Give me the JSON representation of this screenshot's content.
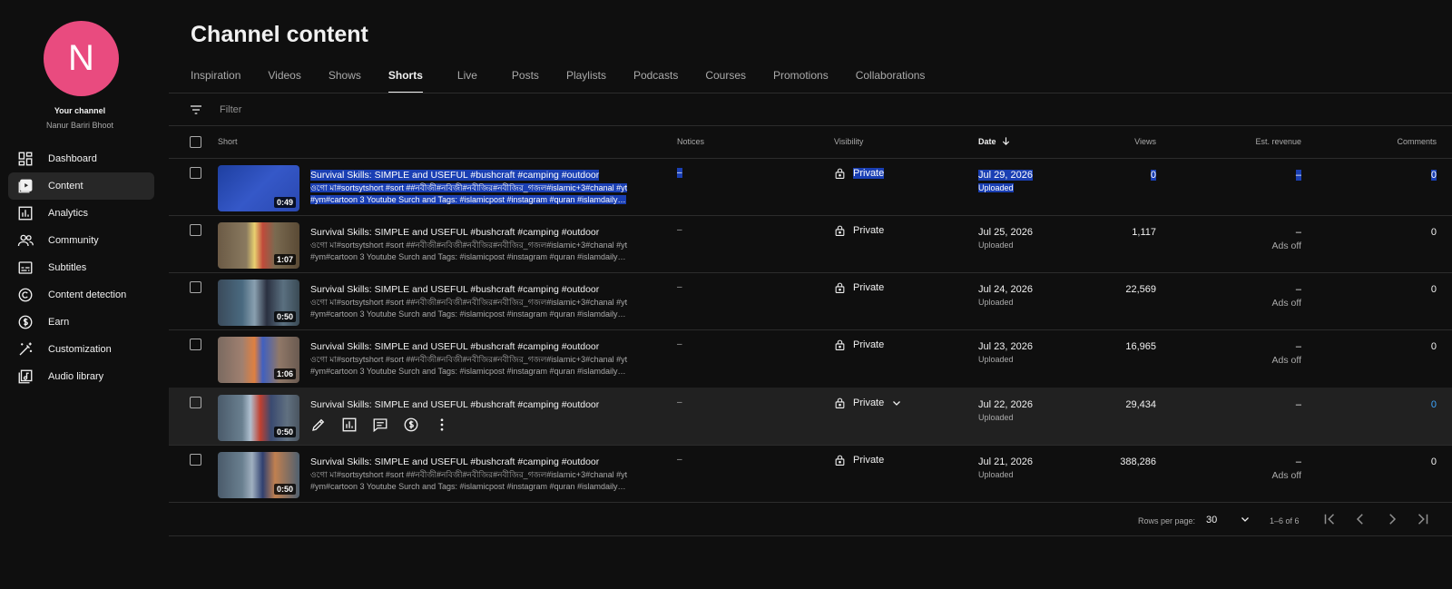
{
  "sidebar": {
    "avatar_letter": "N",
    "avatar_color": "#e94b7f",
    "your_channel": "Your channel",
    "channel_name": "Nanur Bariri Bhoot",
    "items": [
      {
        "label": "Dashboard",
        "icon": "dashboard-icon"
      },
      {
        "label": "Content",
        "icon": "content-icon"
      },
      {
        "label": "Analytics",
        "icon": "analytics-icon"
      },
      {
        "label": "Community",
        "icon": "community-icon"
      },
      {
        "label": "Subtitles",
        "icon": "subtitles-icon"
      },
      {
        "label": "Content detection",
        "icon": "copyright-icon"
      },
      {
        "label": "Earn",
        "icon": "dollar-icon"
      },
      {
        "label": "Customization",
        "icon": "magic-wand-icon"
      },
      {
        "label": "Audio library",
        "icon": "audio-library-icon"
      }
    ]
  },
  "main": {
    "title": "Channel content",
    "tabs": [
      "Inspiration",
      "Videos",
      "Shows",
      "Shorts",
      "Live",
      "Posts",
      "Playlists",
      "Podcasts",
      "Courses",
      "Promotions",
      "Collaborations"
    ],
    "active_tab": "Shorts",
    "filter_placeholder": "Filter",
    "columns": {
      "short": "Short",
      "notices": "Notices",
      "visibility": "Visibility",
      "date": "Date",
      "views": "Views",
      "revenue": "Est. revenue",
      "comments": "Comments"
    }
  },
  "rows": [
    {
      "duration": "0:49",
      "title": "Survival Skills: SIMPLE and USEFUL #bushcraft #camping #outdoor",
      "desc": "ওগো মা#sortsytshort #sort ##নবীজী#নবিজী#নবীজির#নবীজির_গজল#islamic+3#chanal #yt #ym#cartoon 3 Youtube Surch and Tags: #islamicpost #instagram #quran #islamdaily…",
      "notices": "–",
      "visibility": "Private",
      "date": "Jul 29, 2026",
      "status": "Uploaded",
      "views": "0",
      "revenue": "–",
      "revenue_note": "",
      "comments": "0"
    },
    {
      "duration": "1:07",
      "title": "Survival Skills: SIMPLE and USEFUL #bushcraft #camping #outdoor",
      "desc": "ওগো মা#sortsytshort #sort ##নবীজী#নবিজী#নবীজির#নবীজির_গজল#islamic+3#chanal #yt #ym#cartoon 3 Youtube Surch and Tags: #islamicpost #instagram #quran #islamdaily…",
      "notices": "–",
      "visibility": "Private",
      "date": "Jul 25, 2026",
      "status": "Uploaded",
      "views": "1,117",
      "revenue": "–",
      "revenue_note": "Ads off",
      "comments": "0"
    },
    {
      "duration": "0:50",
      "title": "Survival Skills: SIMPLE and USEFUL #bushcraft #camping #outdoor",
      "desc": "ওগো মা#sortsytshort #sort ##নবীজী#নবিজী#নবীজির#নবীজির_গজল#islamic+3#chanal #yt #ym#cartoon 3 Youtube Surch and Tags: #islamicpost #instagram #quran #islamdaily…",
      "notices": "–",
      "visibility": "Private",
      "date": "Jul 24, 2026",
      "status": "Uploaded",
      "views": "22,569",
      "revenue": "–",
      "revenue_note": "Ads off",
      "comments": "0"
    },
    {
      "duration": "1:06",
      "title": "Survival Skills: SIMPLE and USEFUL #bushcraft #camping #outdoor",
      "desc": "ওগো মা#sortsytshort #sort ##নবীজী#নবিজী#নবীজির#নবীজির_গজল#islamic+3#chanal #yt #ym#cartoon 3 Youtube Surch and Tags: #islamicpost #instagram #quran #islamdaily…",
      "notices": "–",
      "visibility": "Private",
      "date": "Jul 23, 2026",
      "status": "Uploaded",
      "views": "16,965",
      "revenue": "–",
      "revenue_note": "Ads off",
      "comments": "0"
    },
    {
      "duration": "0:50",
      "title": "Survival Skills: SIMPLE and USEFUL #bushcraft #camping #outdoor",
      "desc": "",
      "notices": "–",
      "visibility": "Private",
      "date": "Jul 22, 2026",
      "status": "Uploaded",
      "views": "29,434",
      "revenue": "–",
      "revenue_note": "",
      "comments": "0"
    },
    {
      "duration": "0:50",
      "title": "Survival Skills: SIMPLE and USEFUL #bushcraft #camping #outdoor",
      "desc": "ওগো মা#sortsytshort #sort ##নবীজী#নবিজী#নবীজির#নবীজির_গজল#islamic+3#chanal #yt #ym#cartoon 3 Youtube Surch and Tags: #islamicpost #instagram #quran #islamdaily…",
      "notices": "–",
      "visibility": "Private",
      "date": "Jul 21, 2026",
      "status": "Uploaded",
      "views": "388,286",
      "revenue": "–",
      "revenue_note": "Ads off",
      "comments": "0"
    }
  ],
  "pagination": {
    "rows_per_page_label": "Rows per page:",
    "rows_per_page": "30",
    "range": "1–6 of 6"
  }
}
